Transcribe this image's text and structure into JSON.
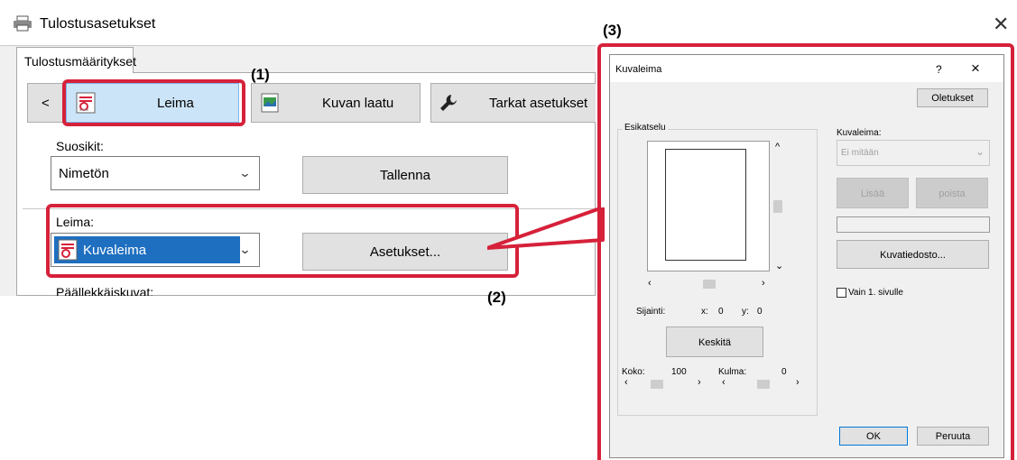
{
  "window": {
    "title": "Tulostusasetukset"
  },
  "tab": {
    "label": "Tulostusmääritykset"
  },
  "nav": {
    "back": "<",
    "leima": "Leima",
    "kuvan_laatu": "Kuvan laatu",
    "tarkat": "Tarkat asetukset"
  },
  "favorites": {
    "label": "Suosikit:",
    "value": "Nimetön",
    "save": "Tallenna"
  },
  "stamp": {
    "label": "Leima:",
    "value": "Kuvaleima",
    "settings": "Asetukset..."
  },
  "overlay": {
    "label": "Päällekkäiskuvat:"
  },
  "callouts": {
    "c1": "(1)",
    "c2": "(2)",
    "c3": "(3)"
  },
  "dialog": {
    "title": "Kuvaleima",
    "help": "?",
    "close": "×",
    "defaults": "Oletukset",
    "preview_label": "Esikatselu",
    "position_label": "Sijainti:",
    "x_label": "x:",
    "x_value": "0",
    "y_label": "y:",
    "y_value": "0",
    "center": "Keskitä",
    "size_label": "Koko:",
    "size_value": "100",
    "angle_label": "Kulma:",
    "angle_value": "0",
    "stamp_label": "Kuvaleima:",
    "stamp_value": "Ei mitään",
    "add": "Lisää",
    "delete": "poista",
    "image_file": "Kuvatiedosto...",
    "first_page": "Vain 1. sivulle",
    "ok": "OK",
    "cancel": "Peruuta"
  },
  "colors": {
    "accent_red": "#d6213a",
    "selected_blue": "#1e6fc0",
    "tab_highlight": "#cce4f7"
  }
}
